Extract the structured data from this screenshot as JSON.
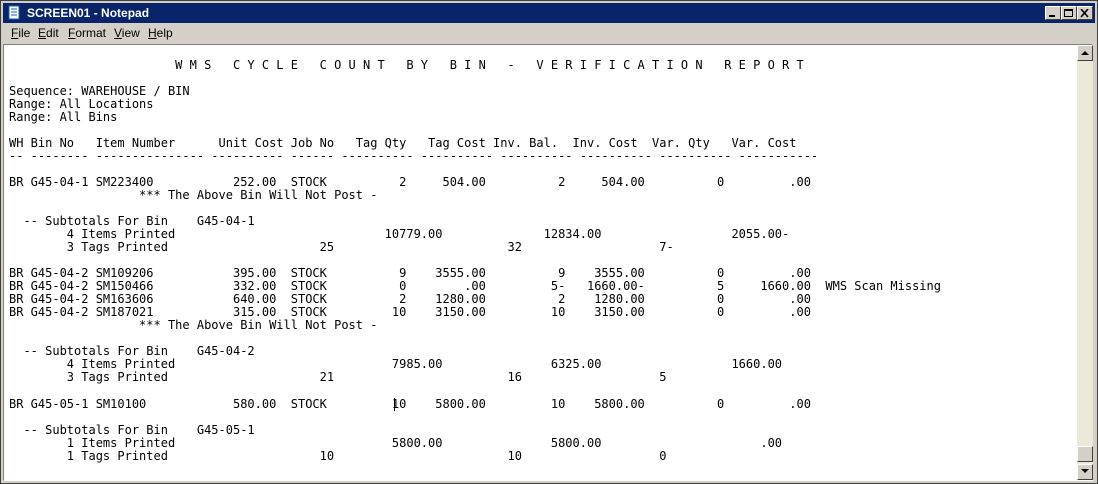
{
  "window": {
    "title": "SCREEN01 - Notepad"
  },
  "menu": [
    {
      "label": "File",
      "mnemonic": "F",
      "rest": "ile"
    },
    {
      "label": "Edit",
      "mnemonic": "E",
      "rest": "dit"
    },
    {
      "label": "Format",
      "mnemonic": "F",
      "rest": "ormat"
    },
    {
      "label": "View",
      "mnemonic": "V",
      "rest": "iew"
    },
    {
      "label": "Help",
      "mnemonic": "H",
      "rest": "elp"
    }
  ],
  "document": {
    "lines": [
      "                       W M S   C Y C L E   C O U N T   B Y   B I N   -   V E R I F I C A T I O N   R E P O R T",
      "",
      "Sequence: WAREHOUSE / BIN",
      "Range: All Locations",
      "Range: All Bins",
      "",
      "WH Bin No   Item Number      Unit Cost Job No   Tag Qty   Tag Cost Inv. Bal.  Inv. Cost  Var. Qty   Var. Cost",
      "-- -------- --------------- ---------- ------ ---------- ---------- ---------- ---------- ---------- -----------",
      "",
      "BR G45-04-1 SM223400           252.00  STOCK          2     504.00          2     504.00          0         .00",
      "                  *** The Above Bin Will Not Post -",
      "",
      "  -- Subtotals For Bin    G45-04-1",
      "        4 Items Printed                             10779.00              12834.00                  2055.00-",
      "        3 Tags Printed                     25                        32                   7-",
      "",
      "BR G45-04-2 SM109206           395.00  STOCK          9    3555.00          9    3555.00          0         .00",
      "BR G45-04-2 SM150466           332.00  STOCK          0        .00         5-   1660.00-          5     1660.00  WMS Scan Missing",
      "BR G45-04-2 SM163606           640.00  STOCK          2    1280.00          2    1280.00          0         .00",
      "BR G45-04-2 SM187021           315.00  STOCK         10    3150.00         10    3150.00          0         .00",
      "                  *** The Above Bin Will Not Post -",
      "",
      "  -- Subtotals For Bin    G45-04-2",
      "        4 Items Printed                              7985.00               6325.00                  1660.00",
      "        3 Tags Printed                     21                        16                   5",
      "",
      "BR G45-05-1 SM10100            580.00  STOCK         10    5800.00         10    5800.00          0         .00",
      "",
      "  -- Subtotals For Bin    G45-05-1",
      "        1 Items Printed                              5800.00               5800.00                      .00",
      "        1 Tags Printed                     10                        10                   0"
    ]
  }
}
